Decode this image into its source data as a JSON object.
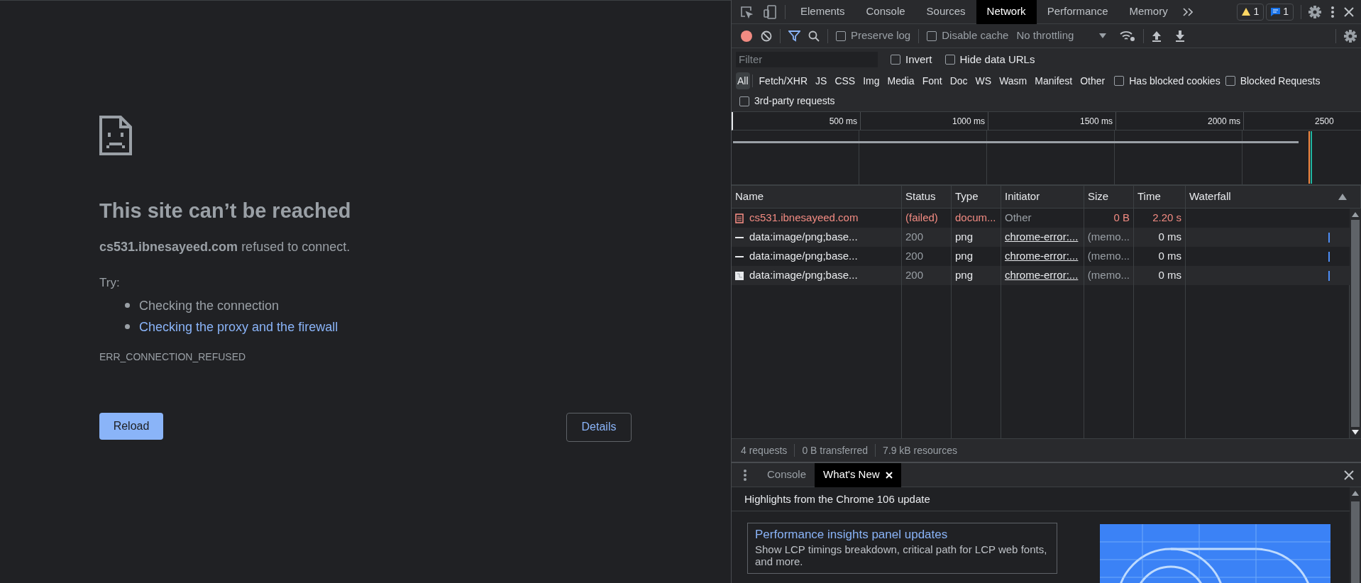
{
  "page": {
    "title": "This site can’t be reached",
    "host": "cs531.ibnesayeed.com",
    "message": "refused to connect.",
    "try_label": "Try:",
    "suggestions": [
      {
        "text": "Checking the connection",
        "kind": "plain"
      },
      {
        "text": "Checking the proxy and the firewall",
        "kind": "link"
      }
    ],
    "error_code": "ERR_CONNECTION_REFUSED",
    "reload_button": "Reload",
    "details_button": "Details"
  },
  "devtools": {
    "tabs": [
      {
        "label": "Elements",
        "selected": false
      },
      {
        "label": "Console",
        "selected": false
      },
      {
        "label": "Sources",
        "selected": false
      },
      {
        "label": "Network",
        "selected": true
      },
      {
        "label": "Performance",
        "selected": false
      },
      {
        "label": "Memory",
        "selected": false
      }
    ],
    "warnings_badge": "1",
    "messages_badge": "1",
    "toolbar": {
      "recording": true,
      "preserve_log": {
        "label": "Preserve log",
        "checked": false
      },
      "disable_cache": {
        "label": "Disable cache",
        "checked": false
      },
      "throttling": "No throttling"
    },
    "filter": {
      "placeholder": "Filter"
    },
    "invert": {
      "label": "Invert",
      "checked": false
    },
    "hide_data_urls": {
      "label": "Hide data URLs",
      "checked": false
    },
    "type_filters": [
      {
        "label": "All",
        "selected": true
      },
      {
        "label": "Fetch/XHR",
        "selected": false
      },
      {
        "label": "JS",
        "selected": false
      },
      {
        "label": "CSS",
        "selected": false
      },
      {
        "label": "Img",
        "selected": false
      },
      {
        "label": "Media",
        "selected": false
      },
      {
        "label": "Font",
        "selected": false
      },
      {
        "label": "Doc",
        "selected": false
      },
      {
        "label": "WS",
        "selected": false
      },
      {
        "label": "Wasm",
        "selected": false
      },
      {
        "label": "Manifest",
        "selected": false
      },
      {
        "label": "Other",
        "selected": false
      }
    ],
    "has_blocked_cookies": {
      "label": "Has blocked cookies",
      "checked": false
    },
    "blocked_requests": {
      "label": "Blocked Requests",
      "checked": false
    },
    "third_party": {
      "label": "3rd-party requests",
      "checked": false
    },
    "timeline_ticks": [
      "500 ms",
      "1000 ms",
      "1500 ms",
      "2000 ms",
      "2500"
    ],
    "table": {
      "columns": [
        "Name",
        "Status",
        "Type",
        "Initiator",
        "Size",
        "Time",
        "Waterfall"
      ],
      "rows": [
        {
          "kind": "document",
          "failed": true,
          "name": "cs531.ibnesayeed.com",
          "status": "(failed)",
          "type": "docum...",
          "initiator": "Other",
          "size": "0 B",
          "time": "2.20 s"
        },
        {
          "kind": "dash",
          "failed": false,
          "name": "data:image/png;base...",
          "status": "200",
          "type": "png",
          "initiator": "chrome-error:...",
          "size": "(memo...",
          "time": "0 ms"
        },
        {
          "kind": "dash",
          "failed": false,
          "name": "data:image/png;base...",
          "status": "200",
          "type": "png",
          "initiator": "chrome-error:...",
          "size": "(memo...",
          "time": "0 ms"
        },
        {
          "kind": "image",
          "failed": false,
          "name": "data:image/png;base...",
          "status": "200",
          "type": "png",
          "initiator": "chrome-error:...",
          "size": "(memo...",
          "time": "0 ms"
        }
      ]
    },
    "summary": [
      "4 requests",
      "0 B transferred",
      "7.9 kB resources"
    ],
    "drawer": {
      "tabs": [
        {
          "label": "Console",
          "selected": false,
          "closable": false
        },
        {
          "label": "What's New",
          "selected": true,
          "closable": true
        }
      ],
      "heading": "Highlights from the Chrome 106 update",
      "cards": [
        {
          "title": "Performance insights panel updates",
          "description": "Show LCP timings breakdown, critical path for LCP web fonts, and more."
        }
      ]
    }
  }
}
